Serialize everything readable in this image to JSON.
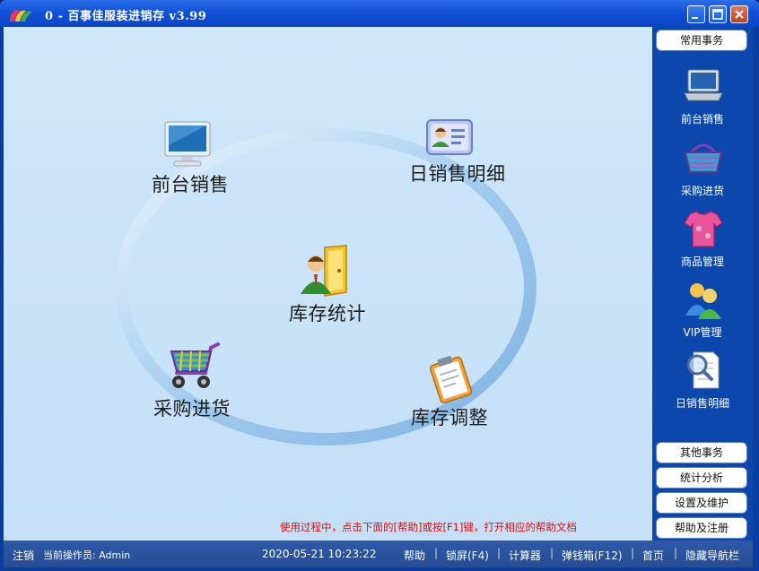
{
  "window": {
    "title": "0 - 百事佳服装进销存 v3.99"
  },
  "main": {
    "tiles": {
      "front_sales": "前台销售",
      "daily_detail": "日销售明细",
      "inventory_stats": "库存统计",
      "purchase": "采购进货",
      "inventory_adjust": "库存调整"
    },
    "hint": "使用过程中，点击下面的[帮助]或按[F1]键，打开相应的帮助文档"
  },
  "sidebar": {
    "common_tasks": "常用事务",
    "items": [
      {
        "label": "前台销售",
        "icon": "laptop-icon"
      },
      {
        "label": "采购进货",
        "icon": "shopping-basket-icon"
      },
      {
        "label": "商品管理",
        "icon": "tshirt-icon"
      },
      {
        "label": "VIP管理",
        "icon": "users-icon"
      },
      {
        "label": "日销售明细",
        "icon": "document-search-icon"
      }
    ],
    "bottom": {
      "other_tasks": "其他事务",
      "stats": "统计分析",
      "settings": "设置及维护",
      "help_register": "帮助及注册"
    }
  },
  "statusbar": {
    "logout": "注销",
    "operator": "当前操作员: Admin",
    "datetime": "2020-05-21 10:23:22",
    "help": "帮助",
    "lock": "锁屏(F4)",
    "calculator": "计算器",
    "cash_drawer": "弹钱箱(F12)",
    "home": "首页",
    "hide_nav": "隐藏导航栏"
  },
  "colors": {
    "titlebar": "#1151d6",
    "workspace": "#cfe7fb",
    "sidebar": "#0c47ad",
    "statusbar": "#2f5aa8",
    "hint": "#e01010"
  }
}
